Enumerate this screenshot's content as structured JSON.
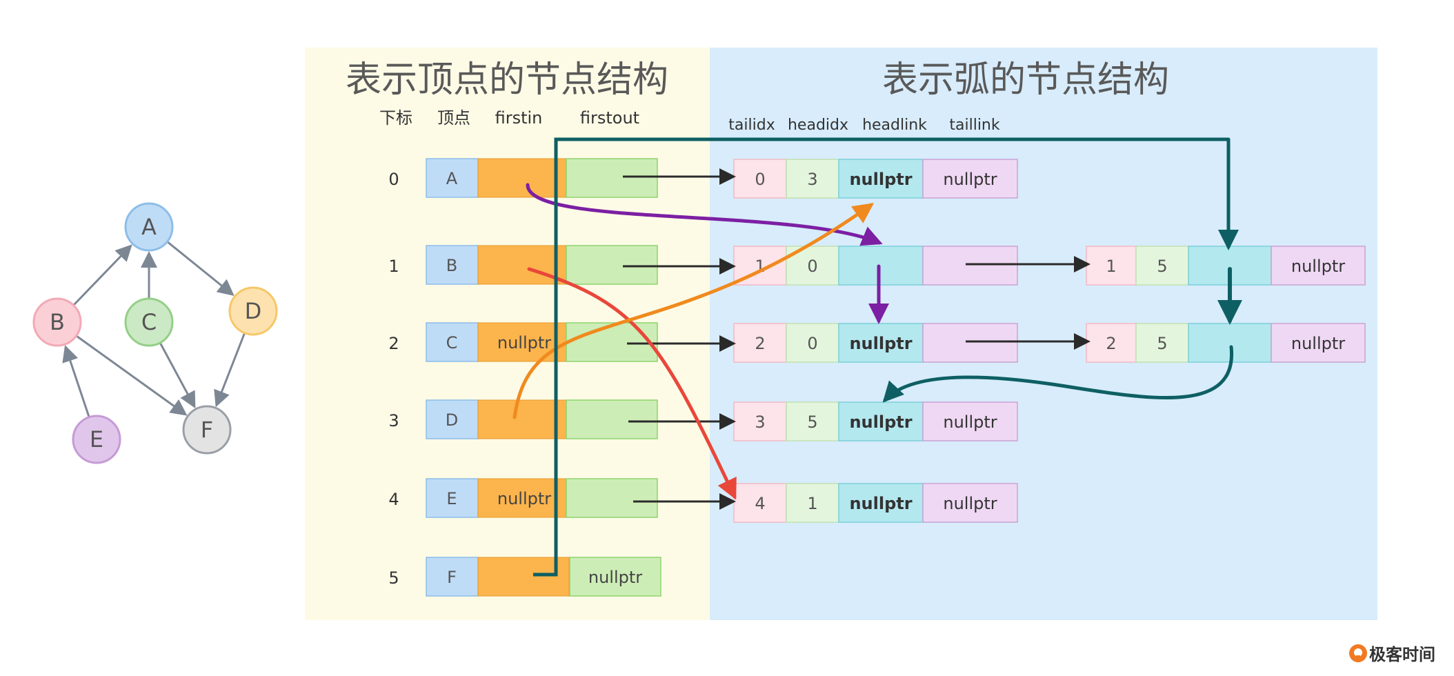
{
  "vertex_panel": {
    "title": "表示顶点的节点结构",
    "headers": [
      "下标",
      "顶点",
      "firstin",
      "firstout"
    ],
    "rows": [
      {
        "index": "0",
        "vertex": "A",
        "firstin": "",
        "firstout": ""
      },
      {
        "index": "1",
        "vertex": "B",
        "firstin": "",
        "firstout": ""
      },
      {
        "index": "2",
        "vertex": "C",
        "firstin": "nullptr",
        "firstout": ""
      },
      {
        "index": "3",
        "vertex": "D",
        "firstin": "",
        "firstout": ""
      },
      {
        "index": "4",
        "vertex": "E",
        "firstin": "nullptr",
        "firstout": ""
      },
      {
        "index": "5",
        "vertex": "F",
        "firstin": "",
        "firstout": "nullptr"
      }
    ]
  },
  "arc_panel": {
    "title": "表示弧的节点结构",
    "headers": [
      "tailidx",
      "headidx",
      "headlink",
      "taillink"
    ],
    "arcs": [
      {
        "id": "a03",
        "tailidx": "0",
        "headidx": "3",
        "headlink": "nullptr",
        "taillink": "nullptr"
      },
      {
        "id": "a10",
        "tailidx": "1",
        "headidx": "0",
        "headlink": "",
        "taillink": ""
      },
      {
        "id": "a15",
        "tailidx": "1",
        "headidx": "5",
        "headlink": "",
        "taillink": "nullptr"
      },
      {
        "id": "a20",
        "tailidx": "2",
        "headidx": "0",
        "headlink": "nullptr",
        "taillink": ""
      },
      {
        "id": "a25",
        "tailidx": "2",
        "headidx": "5",
        "headlink": "",
        "taillink": "nullptr"
      },
      {
        "id": "a35",
        "tailidx": "3",
        "headidx": "5",
        "headlink": "nullptr",
        "taillink": "nullptr"
      },
      {
        "id": "a41",
        "tailidx": "4",
        "headidx": "1",
        "headlink": "nullptr",
        "taillink": "nullptr"
      }
    ]
  },
  "graph": {
    "nodes": [
      {
        "id": "A",
        "label": "A",
        "fill": "#bfdcf7",
        "stroke": "#8dbde8"
      },
      {
        "id": "B",
        "label": "B",
        "fill": "#fbcfd6",
        "stroke": "#f2a9b5"
      },
      {
        "id": "C",
        "label": "C",
        "fill": "#cbe9c4",
        "stroke": "#94cf88"
      },
      {
        "id": "D",
        "label": "D",
        "fill": "#fde2b0",
        "stroke": "#f6c766"
      },
      {
        "id": "E",
        "label": "E",
        "fill": "#e1c6eb",
        "stroke": "#c59ad6"
      },
      {
        "id": "F",
        "label": "F",
        "fill": "#e3e3e3",
        "stroke": "#9a9fa6"
      }
    ],
    "edges": [
      [
        "B",
        "A"
      ],
      [
        "C",
        "A"
      ],
      [
        "A",
        "D"
      ],
      [
        "B",
        "F"
      ],
      [
        "C",
        "F"
      ],
      [
        "D",
        "F"
      ],
      [
        "E",
        "B"
      ]
    ]
  },
  "brand": {
    "name": "极客时间"
  },
  "colors": {
    "vertex_bg": "#fdfbe6",
    "arc_bg": "#d8ecfb",
    "vertex_cell": "#bfdcf7",
    "firstin_cell": "#fcb44c",
    "firstout_cell": "#cdedb6",
    "tail_cell": "#fde3ea",
    "head_cell": "#e4f5dd",
    "headlink_cell": "#b3e8ef",
    "taillink_cell": "#efd8f3",
    "pointer_black": "#2a2a2a",
    "link_purple": "#7c1fa3",
    "link_red": "#e9473a",
    "link_orange": "#f08a1e",
    "link_teal": "#0e5f63",
    "graph_edge": "#7d8794",
    "brand": "#f07a22"
  },
  "links": [
    {
      "id": "A-firstin",
      "color": "link_purple"
    },
    {
      "id": "B-firstin",
      "color": "link_red"
    },
    {
      "id": "D-firstin",
      "color": "link_orange"
    },
    {
      "id": "F-firstin",
      "color": "link_teal"
    },
    {
      "id": "a10-headlink",
      "color": "link_purple"
    },
    {
      "id": "a15-headlink",
      "color": "link_teal"
    },
    {
      "id": "a25-headlink",
      "color": "link_teal"
    }
  ]
}
